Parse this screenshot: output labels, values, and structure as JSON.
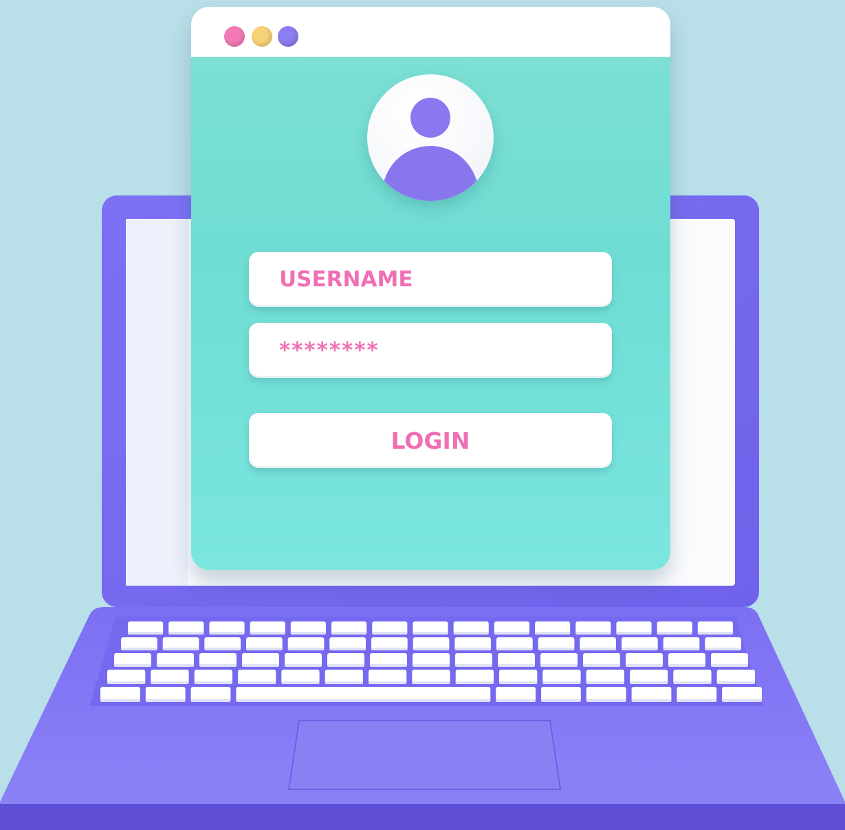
{
  "login": {
    "username_placeholder": "USERNAME",
    "password_placeholder": "********",
    "login_label": "LOGIN"
  },
  "window": {
    "controls": [
      "close-dot",
      "minimize-dot",
      "maximize-dot"
    ]
  },
  "colors": {
    "background": "#b9dfe8",
    "laptop": "#7b6df2",
    "window_panel": "#72ddd4",
    "accent_text": "#f06fb4",
    "avatar": "#8a78f0",
    "dot_pink": "#f27bb5",
    "dot_yellow": "#f6d277",
    "dot_purple": "#8b7ef2"
  },
  "icons": {
    "avatar": "user-avatar-icon"
  }
}
